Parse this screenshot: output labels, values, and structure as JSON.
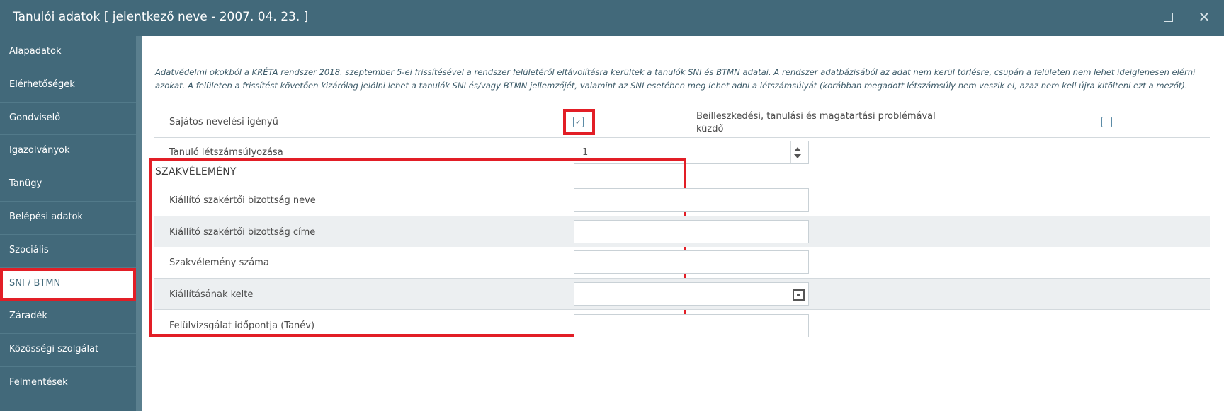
{
  "window": {
    "title": "Tanulói adatok [ jelentkező neve - 2007. 04. 23. ]",
    "maximize_icon": "maximize-icon",
    "close_icon": "close-icon",
    "close_glyph": "✕"
  },
  "sidebar": {
    "items": [
      {
        "label": "Alapadatok"
      },
      {
        "label": "Elérhetőségek"
      },
      {
        "label": "Gondviselő"
      },
      {
        "label": "Igazolványok"
      },
      {
        "label": "Tanügy"
      },
      {
        "label": "Belépési adatok"
      },
      {
        "label": "Szociális"
      },
      {
        "label": "SNI / BTMN",
        "active": true
      },
      {
        "label": "Záradék"
      },
      {
        "label": "Közösségi szolgálat"
      },
      {
        "label": "Felmentések"
      }
    ]
  },
  "notice": "Adatvédelmi okokból a KRÉTA rendszer 2018. szeptember 5-ei frissítésével a rendszer felületéről eltávolításra kerültek a tanulók SNI és BTMN adatai. A rendszer adatbázisából az adat nem kerül törlésre, csupán a felületen nem lehet ideiglenesen elérni azokat. A felületen a frissítést követően kizárólag jelölni lehet a tanulók SNI és/vagy BTMN jellemzőjét, valamint az SNI esetében meg lehet adni a létszámsúlyát (korábban megadott létszámsúly nem veszik el, azaz nem kell újra kitölteni ezt a mezőt).",
  "form": {
    "sni_label": "Sajátos nevelési igényű",
    "sni_checked": true,
    "check_glyph": "✓",
    "btmn_label_line1": "Beilleszkedési, tanulási és magatartási problémával",
    "btmn_label_line2": "küzdő",
    "btmn_checked": false,
    "weight_label": "Tanuló létszámsúlyozása",
    "weight_value": "1"
  },
  "szakvelemeny": {
    "title": "SZAKVÉLEMÉNY",
    "fields": [
      {
        "label": "Kiállító szakértői bizottság neve",
        "value": ""
      },
      {
        "label": "Kiállító szakértői bizottság címe",
        "value": ""
      },
      {
        "label": "Szakvélemény száma",
        "value": ""
      },
      {
        "label": "Kiállításának kelte",
        "value": "",
        "icon": "calendar-icon"
      },
      {
        "label": "Felülvizsgálat időpontja (Tanév)",
        "value": ""
      }
    ]
  },
  "colors": {
    "header": "#42697a",
    "highlight": "#e21e26",
    "alt_row": "#eceff1"
  }
}
